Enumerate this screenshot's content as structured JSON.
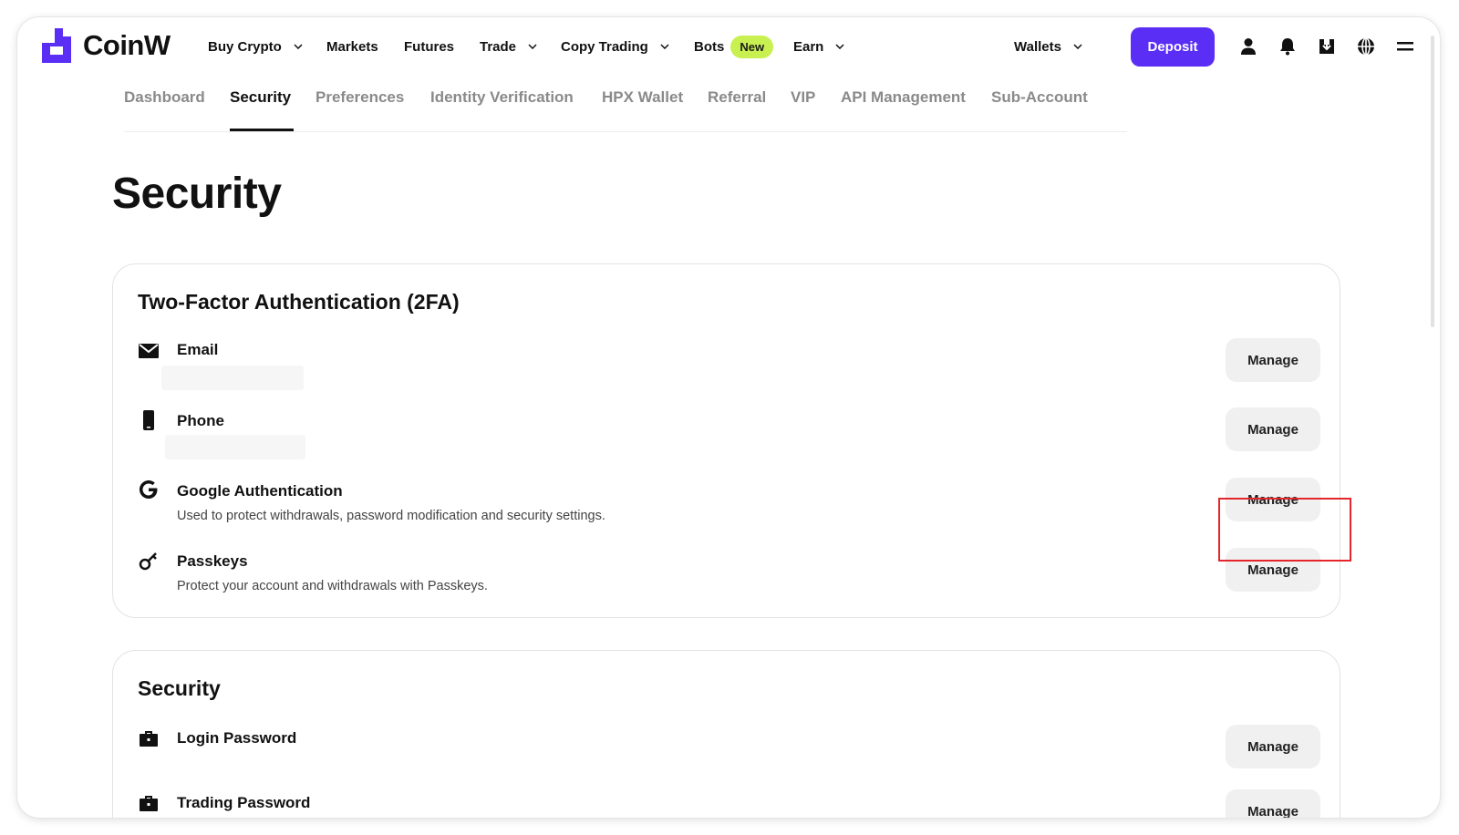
{
  "brand": {
    "name": "CoinW",
    "color": "#5a2ef5"
  },
  "nav": {
    "items": [
      {
        "label": "Buy Crypto",
        "dropdown": true
      },
      {
        "label": "Markets",
        "dropdown": false
      },
      {
        "label": "Futures",
        "dropdown": false
      },
      {
        "label": "Trade",
        "dropdown": true
      },
      {
        "label": "Copy Trading",
        "dropdown": true
      },
      {
        "label": "Bots",
        "dropdown": false,
        "badge": "New"
      },
      {
        "label": "Earn",
        "dropdown": true
      }
    ],
    "wallets_label": "Wallets",
    "deposit_label": "Deposit",
    "icons": [
      "user-icon",
      "bell-icon",
      "download-icon",
      "globe-icon",
      "menu-icon"
    ]
  },
  "subtabs": {
    "items": [
      "Dashboard",
      "Security",
      "Preferences",
      "Identity Verification",
      "HPX Wallet",
      "Referral",
      "VIP",
      "API Management",
      "Sub-Account"
    ],
    "active": "Security"
  },
  "page": {
    "title": "Security"
  },
  "two_fa": {
    "title": "Two-Factor Authentication (2FA)",
    "items": [
      {
        "icon": "mail-icon",
        "label": "Email",
        "desc": "",
        "action": "Manage"
      },
      {
        "icon": "phone-icon",
        "label": "Phone",
        "desc": "",
        "action": "Manage"
      },
      {
        "icon": "google-icon",
        "label": "Google Authentication",
        "desc": "Used to protect withdrawals, password modification and security settings.",
        "action": "Manage"
      },
      {
        "icon": "key-icon",
        "label": "Passkeys",
        "desc": "Protect your account and withdrawals with Passkeys.",
        "action": "Manage"
      }
    ]
  },
  "security": {
    "title": "Security",
    "items": [
      {
        "icon": "briefcase-icon",
        "label": "Login Password",
        "action": "Manage"
      },
      {
        "icon": "briefcase-icon",
        "label": "Trading Password",
        "action": "Manage"
      }
    ]
  },
  "colors": {
    "highlight": "#e3262b",
    "badge": "#c8f051",
    "deposit": "#5a2ef5"
  }
}
